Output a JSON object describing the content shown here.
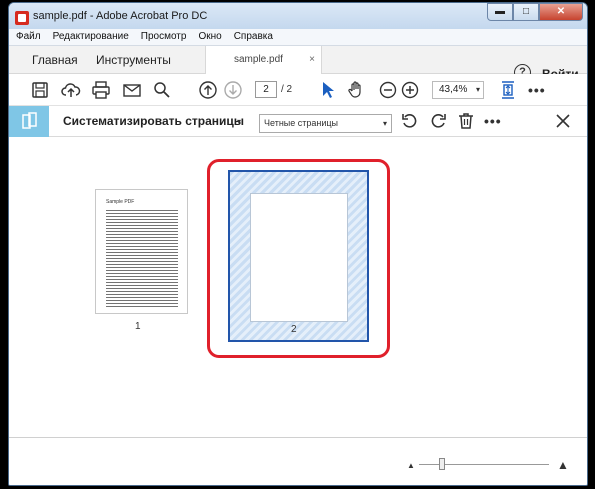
{
  "window": {
    "title": "sample.pdf - Adobe Acrobat Pro DC",
    "controls": {
      "minimize": "▬",
      "maximize": "□",
      "close": "✕"
    }
  },
  "menu": [
    "Файл",
    "Редактирование",
    "Просмотр",
    "Окно",
    "Справка"
  ],
  "tabs": {
    "home": "Главная",
    "tools": "Инструменты",
    "document": "sample.pdf",
    "document_close": "×"
  },
  "header": {
    "help": "?",
    "signin": "Войти"
  },
  "toolbar": {
    "page_current": "2",
    "page_total": "/ 2",
    "zoom": "43,4%",
    "zoom_caret": "▾",
    "more": "•••"
  },
  "organize": {
    "title": "Систематизировать страницы",
    "caret": "▾",
    "range_select": "Четные страницы",
    "range_arrow": "▾",
    "more": "•••",
    "close": "✕"
  },
  "pages": [
    {
      "number": "1",
      "heading": "Sample PDF"
    },
    {
      "number": "2"
    }
  ],
  "status": {
    "zoom_out_symbol": "▲",
    "zoom_in_symbol": "▲"
  },
  "colors": {
    "accent_blue": "#2255aa",
    "selection_red": "#e0202b",
    "organize_strip": "#7fc6e6"
  }
}
